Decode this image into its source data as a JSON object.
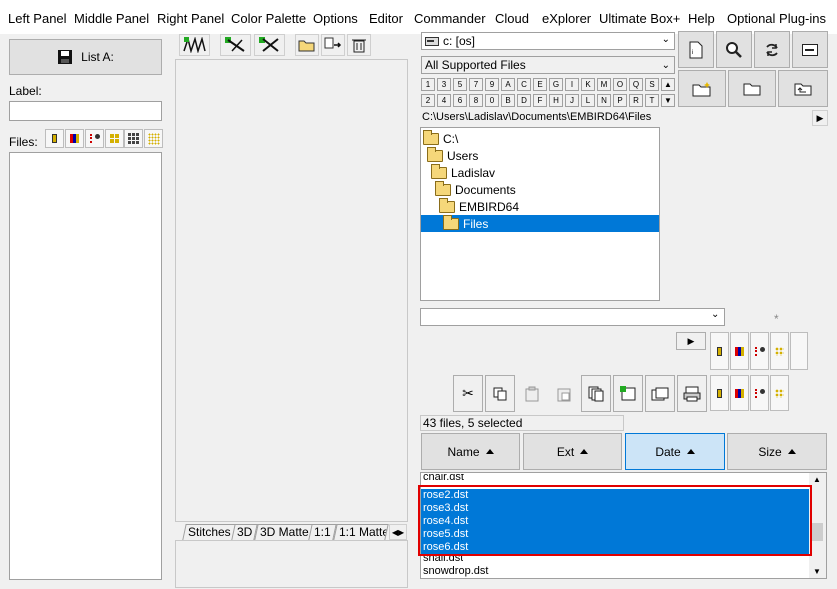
{
  "menu": [
    "Left Panel",
    "Middle Panel",
    "Right Panel",
    "Color Palette",
    "Options",
    "Editor",
    "Commander",
    "Cloud",
    "eXplorer",
    "Ultimate Box+",
    "Help",
    "Optional Plug-ins"
  ],
  "left": {
    "list_button": "List A:",
    "label_caption": "Label:",
    "label_value": "",
    "files_caption": "Files:"
  },
  "middle": {
    "tabs": [
      "Stitches",
      "3D",
      "3D Matte",
      "1:1",
      "1:1 Matte"
    ]
  },
  "right": {
    "drive": "c: [os]",
    "filter": "All Supported Files",
    "keys_row1": [
      "1",
      "3",
      "5",
      "7",
      "9",
      "A",
      "C",
      "E",
      "G",
      "I",
      "K",
      "M",
      "O",
      "Q",
      "S"
    ],
    "keys_row2": [
      "2",
      "4",
      "6",
      "8",
      "0",
      "B",
      "D",
      "F",
      "H",
      "J",
      "L",
      "N",
      "P",
      "R",
      "T"
    ],
    "path": "C:\\Users\\Ladislav\\Documents\\EMBIRD64\\Files",
    "tree": [
      "C:\\",
      "Users",
      "Ladislav",
      "Documents",
      "EMBIRD64",
      "Files"
    ],
    "pattern_value": "",
    "asterisk": "*",
    "status": "43 files, 5 selected",
    "columns": [
      "Name",
      "Ext",
      "Date",
      "Size"
    ],
    "files_top": "chair.dst",
    "files_selected": [
      "rose2.dst",
      "rose3.dst",
      "rose4.dst",
      "rose5.dst",
      "rose6.dst"
    ],
    "files_bottom": [
      "snail.dst",
      "snowdrop.dst"
    ]
  },
  "colors": {
    "selection": "#0078d7",
    "highlight_border": "#e00000",
    "date_header": "#cce4f7"
  }
}
